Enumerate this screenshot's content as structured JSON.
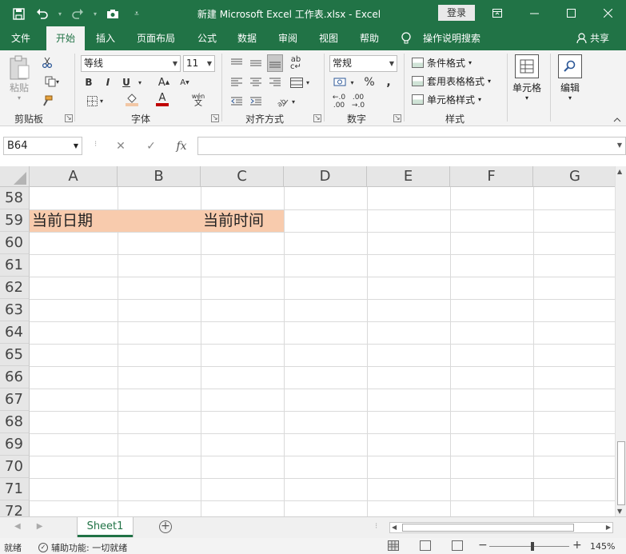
{
  "titlebar": {
    "title": "新建 Microsoft Excel 工作表.xlsx  -  Excel",
    "login_label": "登录",
    "colors": {
      "bg": "#217346",
      "fg": "#ffffff"
    }
  },
  "qat": {
    "save_icon": "save-icon",
    "undo_icon": "undo-icon",
    "redo_icon": "redo-icon",
    "camera_icon": "camera-icon",
    "customize_icon": "customize-qat-icon"
  },
  "ribbon_tabs": {
    "file": "文件",
    "home": "开始",
    "insert": "插入",
    "page_layout": "页面布局",
    "formulas": "公式",
    "data": "数据",
    "review": "审阅",
    "view": "视图",
    "help": "帮助",
    "tell_me": "操作说明搜索",
    "share": "共享",
    "active": "开始"
  },
  "ribbon": {
    "clipboard": {
      "paste": "粘贴",
      "label": "剪贴板"
    },
    "font": {
      "name": "等线",
      "size": "11",
      "bold": "B",
      "italic": "I",
      "underline": "U",
      "grow": "A",
      "shrink": "A",
      "fill": "A",
      "color": "A",
      "phonetic_top": "wén",
      "phonetic_bottom": "文",
      "label": "字体",
      "fill_color": "#f2c7a5",
      "font_color": "#c00000"
    },
    "alignment": {
      "label": "对齐方式"
    },
    "number": {
      "format": "常规",
      "percent": "%",
      "comma": ",",
      "inc_top": "←.0",
      "inc_bottom": ".00",
      "dec_top": ".00",
      "dec_bottom": "→.0",
      "label": "数字"
    },
    "styles": {
      "conditional": "条件格式",
      "table": "套用表格格式",
      "cell": "单元格样式",
      "label": "样式"
    },
    "cells": {
      "label": "单元格"
    },
    "editing": {
      "label": "编辑"
    }
  },
  "formula_bar": {
    "name_box": "B64",
    "cancel": "✕",
    "enter": "✓",
    "fx": "fx",
    "value": ""
  },
  "grid": {
    "columns": [
      "A",
      "B",
      "C",
      "D",
      "E",
      "F",
      "G"
    ],
    "rows": [
      "58",
      "59",
      "60",
      "61",
      "62",
      "63",
      "64",
      "65",
      "66",
      "67",
      "68",
      "69",
      "70",
      "71",
      "72"
    ],
    "cells": {
      "A59": "当前日期",
      "C59": "当前时间"
    },
    "highlight_color": "#f8cbad"
  },
  "sheets": {
    "tabs": [
      "Sheet1"
    ],
    "active": "Sheet1"
  },
  "status": {
    "ready": "就绪",
    "accessibility": "辅助功能: 一切就绪",
    "zoom": "145%"
  }
}
